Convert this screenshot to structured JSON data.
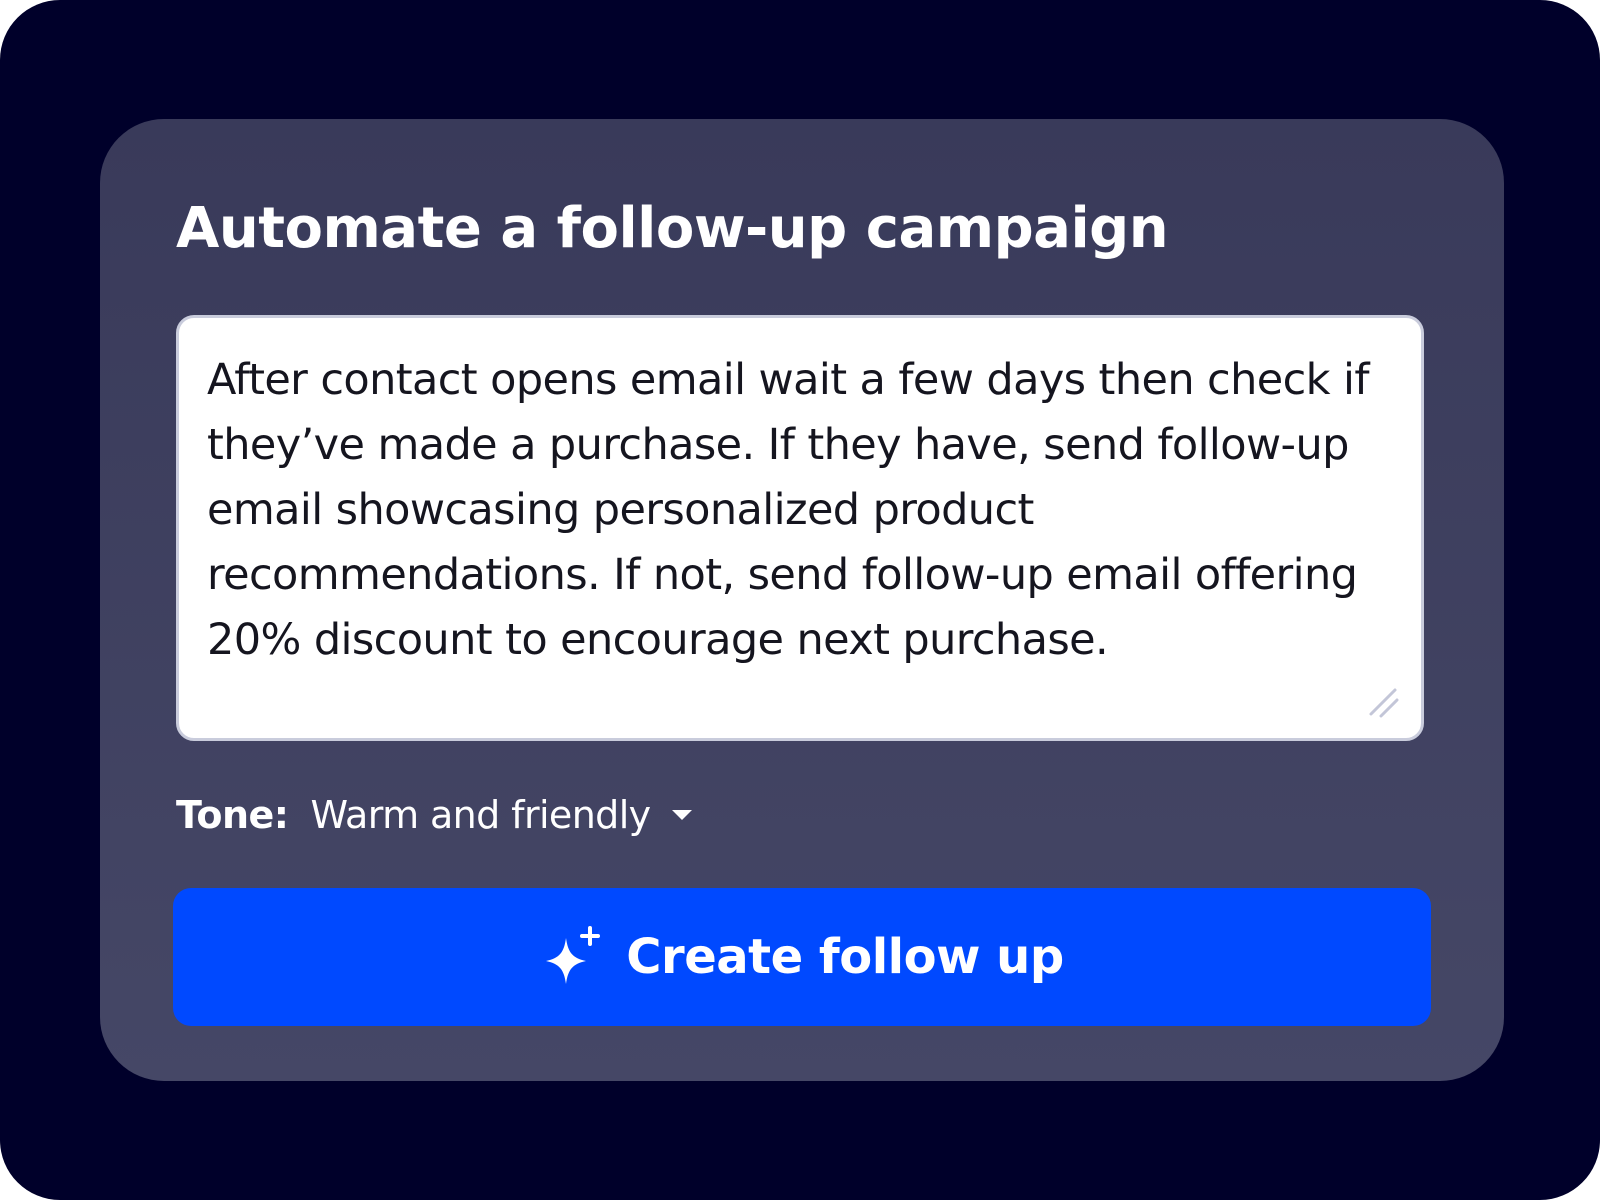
{
  "card": {
    "title": "Automate a follow-up campaign"
  },
  "prompt": {
    "value": "After contact opens email wait a few days then check if they’ve made a purchase. If they have, send follow-up email showcasing personalized product recommendations. If not, send follow-up email offering 20% discount to encourage next purchase."
  },
  "tone": {
    "label": "Tone:",
    "selected": "Warm and friendly"
  },
  "create_button": {
    "label": "Create follow up",
    "icon": "sparkle-icon"
  },
  "colors": {
    "background": "#00002a",
    "card": "#3f4060",
    "accent": "#0049ff",
    "text_dark": "#15151f"
  }
}
